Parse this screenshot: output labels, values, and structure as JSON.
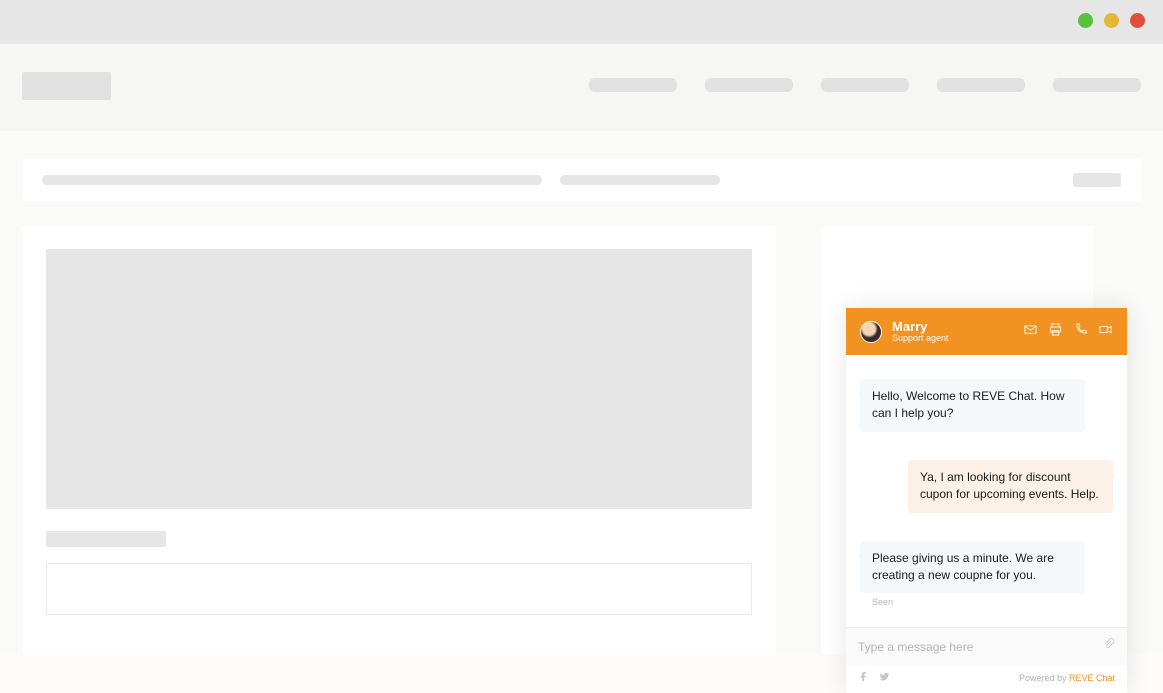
{
  "colors": {
    "accent_orange": "#f29220",
    "skeleton": "#e6e6e6",
    "agent_bubble": "#f5f8fa",
    "user_bubble": "#fcf1e6"
  },
  "chat": {
    "agent": {
      "name": "Marry",
      "role": "Support agent"
    },
    "header_icons": [
      "mail-icon",
      "print-icon",
      "phone-icon",
      "video-icon"
    ],
    "messages": [
      {
        "sender": "agent",
        "text": "Hello, Welcome to REVE Chat. How can I help you?"
      },
      {
        "sender": "user",
        "text": "Ya, I am looking for discount cupon for upcoming events. Help."
      },
      {
        "sender": "agent",
        "text": "Please giving us a minute. We are creating a new coupne for you."
      }
    ],
    "status_label": "Seen",
    "input_placeholder": "Type a message here",
    "footer_social": [
      "facebook-icon",
      "twitter-icon"
    ],
    "powered_prefix": "Powered by ",
    "powered_brand": "REVE Chat"
  }
}
